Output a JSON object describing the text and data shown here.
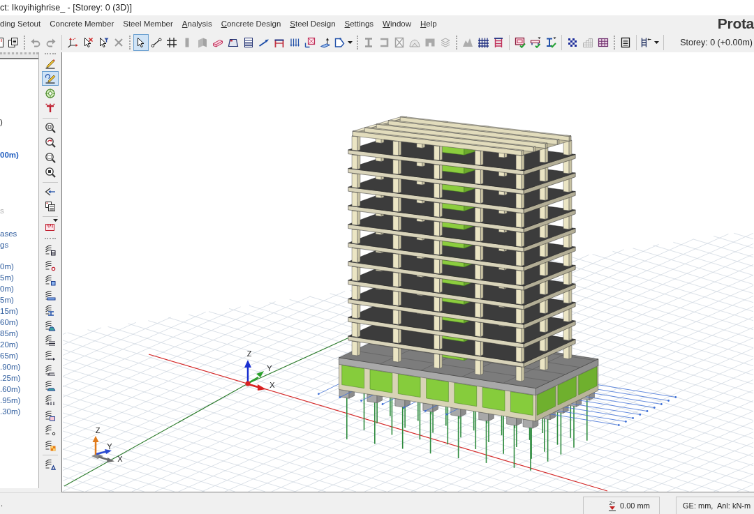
{
  "window": {
    "title": "ct: Ikoyihighrise_ - [Storey: 0 (3D)]"
  },
  "menu_bar": {
    "items": [
      {
        "label": "ding Setout",
        "mnemonic": false
      },
      {
        "label": "Concrete Member",
        "mnemonic": false
      },
      {
        "label": "Steel Member",
        "mnemonic": false
      },
      {
        "label": "Analysis",
        "mnemonic": true
      },
      {
        "label": "Concrete Design",
        "mnemonic": true
      },
      {
        "label": "Steel Design",
        "mnemonic": true
      },
      {
        "label": "Settings",
        "mnemonic": true
      },
      {
        "label": "Window",
        "mnemonic": true
      },
      {
        "label": "Help",
        "mnemonic": true
      }
    ],
    "brand": "Prota"
  },
  "toolbar": {
    "strips": [
      [
        [
          {
            "selected": false,
            "disabled": false,
            "dropdown": false
          },
          {
            "selected": false,
            "disabled": false,
            "dropdown": false
          }
        ]
      ],
      [
        [
          {
            "selected": false,
            "disabled": true,
            "dropdown": false
          },
          {
            "selected": false,
            "disabled": true,
            "dropdown": false
          }
        ],
        [
          {
            "selected": false,
            "disabled": false,
            "dropdown": false
          },
          {
            "selected": false,
            "disabled": false,
            "dropdown": false
          },
          {
            "selected": false,
            "disabled": false,
            "dropdown": false
          },
          {
            "selected": false,
            "disabled": true,
            "dropdown": false
          }
        ]
      ],
      [
        [
          {
            "selected": true,
            "disabled": false,
            "dropdown": false
          },
          {
            "selected": false,
            "disabled": false,
            "dropdown": false
          },
          {
            "selected": false,
            "disabled": false,
            "dropdown": false
          },
          {
            "selected": false,
            "disabled": true,
            "dropdown": false
          },
          {
            "selected": false,
            "disabled": true,
            "dropdown": false
          },
          {
            "selected": false,
            "disabled": false,
            "dropdown": false
          },
          {
            "selected": false,
            "disabled": false,
            "dropdown": false
          },
          {
            "selected": false,
            "disabled": false,
            "dropdown": false
          },
          {
            "selected": false,
            "disabled": false,
            "dropdown": false
          },
          {
            "selected": false,
            "disabled": false,
            "dropdown": false
          },
          {
            "selected": false,
            "disabled": false,
            "dropdown": false
          },
          {
            "selected": false,
            "disabled": false,
            "dropdown": false
          },
          {
            "selected": false,
            "disabled": false,
            "dropdown": false
          },
          {
            "selected": false,
            "disabled": false,
            "dropdown": true
          }
        ]
      ],
      [
        [
          {
            "selected": false,
            "disabled": true,
            "dropdown": false
          },
          {
            "selected": false,
            "disabled": true,
            "dropdown": false
          },
          {
            "selected": false,
            "disabled": true,
            "dropdown": false
          },
          {
            "selected": false,
            "disabled": true,
            "dropdown": false
          },
          {
            "selected": false,
            "disabled": true,
            "dropdown": false
          },
          {
            "selected": false,
            "disabled": true,
            "dropdown": false
          }
        ]
      ],
      [
        [
          {
            "selected": false,
            "disabled": true,
            "dropdown": false
          },
          {
            "selected": false,
            "disabled": false,
            "dropdown": false
          },
          {
            "selected": false,
            "disabled": false,
            "dropdown": false
          }
        ],
        [
          {
            "selected": false,
            "disabled": false,
            "dropdown": false
          },
          {
            "selected": false,
            "disabled": false,
            "dropdown": false
          },
          {
            "selected": false,
            "disabled": false,
            "dropdown": false
          }
        ],
        [
          {
            "selected": false,
            "disabled": false,
            "dropdown": false
          },
          {
            "selected": false,
            "disabled": true,
            "dropdown": false
          },
          {
            "selected": false,
            "disabled": false,
            "dropdown": false
          }
        ]
      ],
      [
        [
          {
            "selected": false,
            "disabled": false,
            "dropdown": false
          }
        ],
        [
          {
            "selected": false,
            "disabled": false,
            "dropdown": true
          }
        ]
      ]
    ],
    "storey": "Storey: 0 (+0.00m)"
  },
  "tree_panel": {
    "items": [
      {
        "text": ")",
        "kind": "heading",
        "selected": false,
        "disabled": false
      },
      {
        "text": "00m)",
        "kind": "item",
        "selected": true,
        "disabled": false
      },
      {
        "text": "s",
        "kind": "item",
        "selected": false,
        "disabled": true
      },
      {
        "text": "ases",
        "kind": "item",
        "selected": false,
        "disabled": false
      },
      {
        "text": "gs",
        "kind": "item",
        "selected": false,
        "disabled": false
      },
      {
        "text": "0m)",
        "kind": "item",
        "selected": false,
        "disabled": false
      },
      {
        "text": "5m)",
        "kind": "item",
        "selected": false,
        "disabled": false
      },
      {
        "text": "0m)",
        "kind": "item",
        "selected": false,
        "disabled": false
      },
      {
        "text": "5m)",
        "kind": "item",
        "selected": false,
        "disabled": false
      },
      {
        "text": "15m)",
        "kind": "item",
        "selected": false,
        "disabled": false
      },
      {
        "text": "60m)",
        "kind": "item",
        "selected": false,
        "disabled": false
      },
      {
        "text": "85m)",
        "kind": "item",
        "selected": false,
        "disabled": false
      },
      {
        "text": "20m)",
        "kind": "item",
        "selected": false,
        "disabled": false
      },
      {
        "text": "65m)",
        "kind": "item",
        "selected": false,
        "disabled": false
      },
      {
        "text": ".90m)",
        "kind": "item",
        "selected": false,
        "disabled": false
      },
      {
        "text": ".25m)",
        "kind": "item",
        "selected": false,
        "disabled": false
      },
      {
        "text": ".60m)",
        "kind": "item",
        "selected": false,
        "disabled": false
      },
      {
        "text": ".95m)",
        "kind": "item",
        "selected": false,
        "disabled": false
      },
      {
        "text": ".30m)",
        "kind": "item",
        "selected": false,
        "disabled": false
      }
    ]
  },
  "side_toolbar": {
    "strips": [
      [
        [
          {
            "selected": false,
            "disabled": false,
            "dropdown": false
          },
          {
            "selected": true,
            "disabled": false,
            "dropdown": false
          },
          {
            "selected": false,
            "disabled": false,
            "dropdown": false
          },
          {
            "selected": false,
            "disabled": false,
            "dropdown": false
          }
        ],
        [
          {
            "selected": false,
            "disabled": false,
            "dropdown": false
          },
          {
            "selected": false,
            "disabled": false,
            "dropdown": false
          },
          {
            "selected": false,
            "disabled": false,
            "dropdown": false
          },
          {
            "selected": false,
            "disabled": false,
            "dropdown": false
          }
        ],
        [
          {
            "selected": false,
            "disabled": false,
            "dropdown": false
          },
          {
            "selected": false,
            "disabled": false,
            "dropdown": false
          }
        ],
        [
          {
            "selected": false,
            "disabled": false,
            "dropdown": true
          }
        ]
      ],
      [
        [
          {
            "selected": false,
            "disabled": false,
            "dropdown": false
          },
          {
            "selected": false,
            "disabled": false,
            "dropdown": false
          },
          {
            "selected": false,
            "disabled": false,
            "dropdown": false
          },
          {
            "selected": false,
            "disabled": false,
            "dropdown": false
          },
          {
            "selected": false,
            "disabled": false,
            "dropdown": false
          },
          {
            "selected": false,
            "disabled": false,
            "dropdown": false
          },
          {
            "selected": false,
            "disabled": false,
            "dropdown": false
          },
          {
            "selected": false,
            "disabled": false,
            "dropdown": false
          },
          {
            "selected": false,
            "disabled": false,
            "dropdown": false
          },
          {
            "selected": false,
            "disabled": false,
            "dropdown": false
          },
          {
            "selected": false,
            "disabled": false,
            "dropdown": false
          },
          {
            "selected": false,
            "disabled": false,
            "dropdown": false
          },
          {
            "selected": false,
            "disabled": false,
            "dropdown": false
          },
          {
            "selected": false,
            "disabled": false,
            "dropdown": false
          }
        ],
        [
          {
            "selected": false,
            "disabled": false,
            "dropdown": false
          }
        ]
      ]
    ]
  },
  "viewport": {
    "origin_axes": [
      "Z",
      "Y",
      "X"
    ],
    "corner_axes": [
      "Z",
      "Y",
      "X"
    ]
  },
  "status_bar": {
    "message": ".",
    "elevation_symbol": "Z=",
    "elevation": "0.00 mm",
    "units": "GE: mm,  Anl: kN-m"
  }
}
